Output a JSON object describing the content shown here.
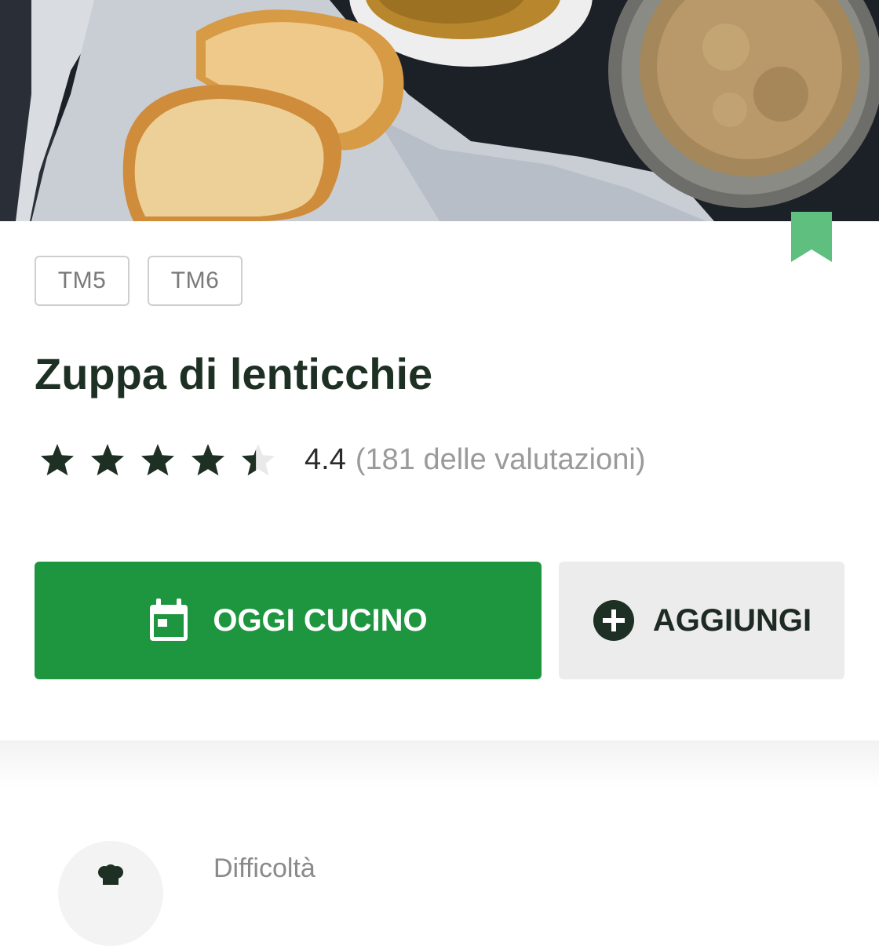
{
  "recipe": {
    "title": "Zuppa di lenticchie",
    "devices": [
      "TM5",
      "TM6"
    ],
    "rating": {
      "value": "4.4",
      "count_text": "(181 delle valutazioni)",
      "stars_out_of_5": 4.4
    }
  },
  "actions": {
    "cook_today_label": "OGGI CUCINO",
    "add_label": "AGGIUNGI"
  },
  "info": {
    "difficulty_label": "Difficoltà"
  },
  "icons": {
    "bookmark": "bookmark-icon",
    "calendar": "calendar-icon",
    "add": "plus-circle-icon",
    "difficulty": "chef-hat-icon"
  },
  "colors": {
    "brand_green": "#1e9640",
    "bookmark_green": "#5fbf7f",
    "title_dark": "#1e3024",
    "star": "#1e3024"
  }
}
